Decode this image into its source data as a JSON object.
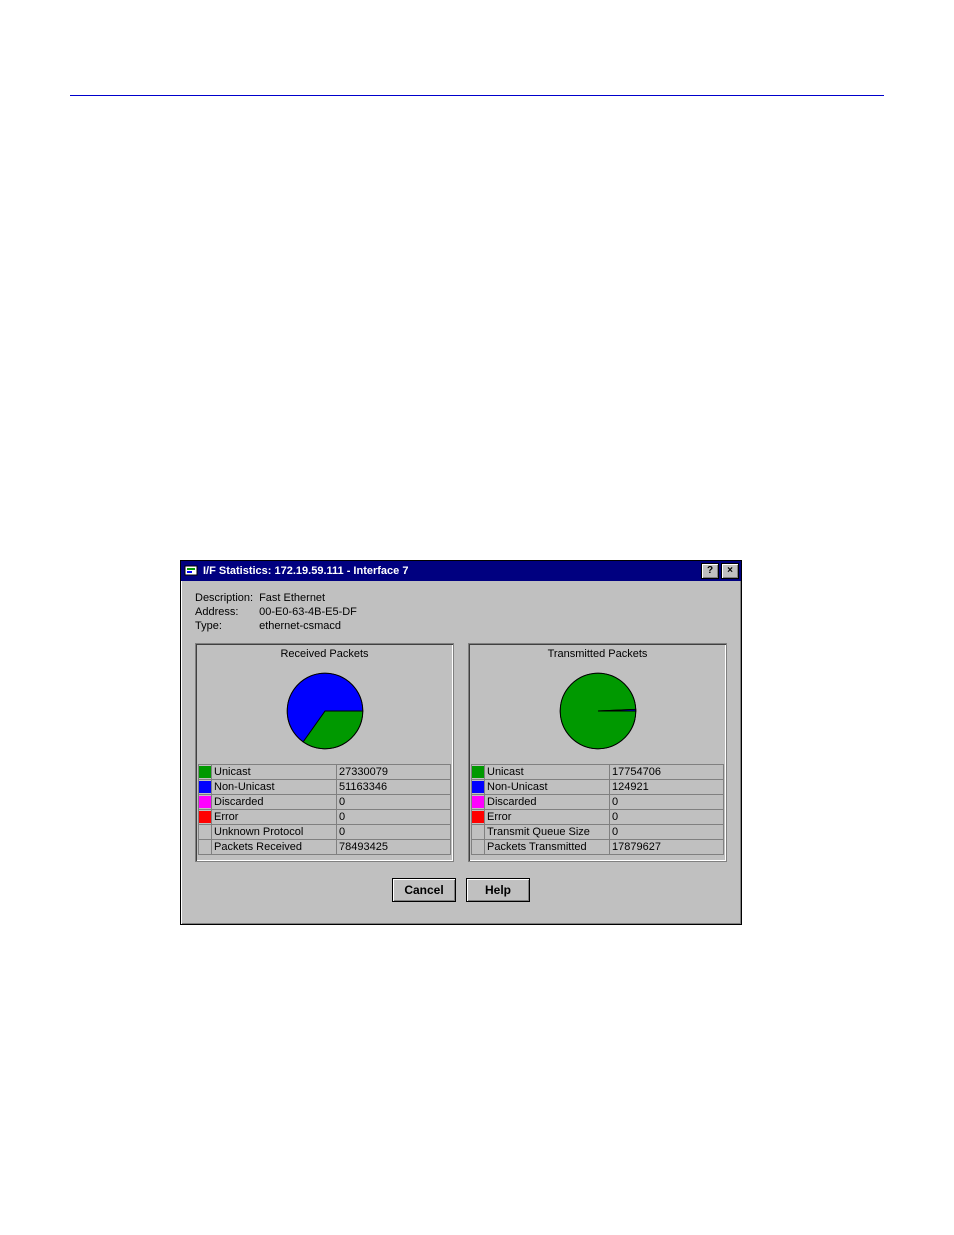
{
  "colors": {
    "unicast": "#009900",
    "nonunicast": "#0000ff",
    "discarded": "#ff00ff",
    "error": "#ff0000",
    "titlebar": "#000080"
  },
  "window": {
    "title": "I/F Statistics: 172.19.59.111 - Interface 7",
    "help_btn": "?",
    "close_btn": "×"
  },
  "info": {
    "description_label": "Description:",
    "description_value": "Fast Ethernet",
    "address_label": "Address:",
    "address_value": "00-E0-63-4B-E5-DF",
    "type_label": "Type:",
    "type_value": "ethernet-csmacd"
  },
  "received": {
    "title": "Received Packets",
    "rows": [
      {
        "swatch": "#009900",
        "label": "Unicast",
        "value": "27330079"
      },
      {
        "swatch": "#0000ff",
        "label": "Non-Unicast",
        "value": "51163346"
      },
      {
        "swatch": "#ff00ff",
        "label": "Discarded",
        "value": "0"
      },
      {
        "swatch": "#ff0000",
        "label": "Error",
        "value": "0"
      },
      {
        "swatch": "",
        "label": "Unknown Protocol",
        "value": "0"
      },
      {
        "swatch": "",
        "label": "Packets Received",
        "value": "78493425"
      }
    ]
  },
  "transmitted": {
    "title": "Transmitted Packets",
    "rows": [
      {
        "swatch": "#009900",
        "label": "Unicast",
        "value": "17754706"
      },
      {
        "swatch": "#0000ff",
        "label": "Non-Unicast",
        "value": "124921"
      },
      {
        "swatch": "#ff00ff",
        "label": "Discarded",
        "value": "0"
      },
      {
        "swatch": "#ff0000",
        "label": "Error",
        "value": "0"
      },
      {
        "swatch": "",
        "label": "Transmit Queue Size",
        "value": "0"
      },
      {
        "swatch": "",
        "label": "Packets Transmitted",
        "value": "17879627"
      }
    ]
  },
  "buttons": {
    "cancel": "Cancel",
    "help": "Help"
  },
  "chart_data": [
    {
      "type": "pie",
      "title": "Received Packets",
      "series": [
        {
          "name": "Unicast",
          "value": 27330079,
          "color": "#009900"
        },
        {
          "name": "Non-Unicast",
          "value": 51163346,
          "color": "#0000ff"
        },
        {
          "name": "Discarded",
          "value": 0,
          "color": "#ff00ff"
        },
        {
          "name": "Error",
          "value": 0,
          "color": "#ff0000"
        }
      ],
      "total": 78493425
    },
    {
      "type": "pie",
      "title": "Transmitted Packets",
      "series": [
        {
          "name": "Unicast",
          "value": 17754706,
          "color": "#009900"
        },
        {
          "name": "Non-Unicast",
          "value": 124921,
          "color": "#0000ff"
        },
        {
          "name": "Discarded",
          "value": 0,
          "color": "#ff00ff"
        },
        {
          "name": "Error",
          "value": 0,
          "color": "#ff0000"
        }
      ],
      "total": 17879627
    }
  ]
}
